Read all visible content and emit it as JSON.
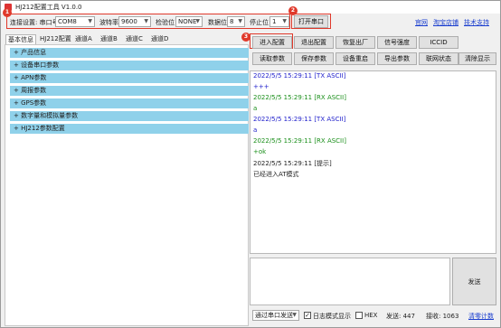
{
  "window": {
    "title": "HJ212配置工具 V1.0.0"
  },
  "toolbar": {
    "conn_label": "连接设置: 串口号",
    "port_value": "COM8",
    "baud_label": "波特率",
    "baud_value": "9600",
    "parity_label": "检验位",
    "parity_value": "NONE",
    "databits_label": "数据位",
    "databits_value": "8",
    "stopbits_label": "停止位",
    "stopbits_value": "1",
    "open_port_label": "打开串口",
    "links": [
      "官网",
      "淘宝店铺",
      "技术支持"
    ]
  },
  "annotations": {
    "badge1": "1",
    "badge2": "2",
    "badge3": "3"
  },
  "tabs": [
    "基本信息",
    "HJ212配置",
    "通道A",
    "通道B",
    "通道C",
    "通道D"
  ],
  "sections": [
    "+ 产品信息",
    "+ 设备串口参数",
    "+ APN参数",
    "+ 周报参数",
    "+ GPS参数",
    "+ 数字量和模拟量参数",
    "+ HJ212参数配置"
  ],
  "action_buttons": {
    "row1": [
      "进入配置",
      "退出配置",
      "恢复出厂",
      "信号强度",
      "ICCID"
    ],
    "row2": [
      "读取参数",
      "保存参数",
      "设备重启",
      "导出参数",
      "联网状态",
      "清除显示"
    ]
  },
  "log": [
    {
      "text": "2022/5/5 15:29:11 [TX ASCII]",
      "color": "blue"
    },
    {
      "text": "+++",
      "color": "blue"
    },
    {
      "text": "2022/5/5 15:29:11 [RX ASCII]",
      "color": "green"
    },
    {
      "text": "a",
      "color": "green"
    },
    {
      "text": "2022/5/5 15:29:11 [TX ASCII]",
      "color": "blue"
    },
    {
      "text": "a",
      "color": "blue"
    },
    {
      "text": "2022/5/5 15:29:11 [RX ASCII]",
      "color": "green"
    },
    {
      "text": "+ok",
      "color": "green"
    },
    {
      "text": "2022/5/5 15:29:11 [提示]",
      "color": "dark"
    },
    {
      "text": "已经进入AT模式",
      "color": "dark"
    }
  ],
  "send": {
    "button_label": "发送",
    "mode_value": "通过串口发送",
    "log_mode_label": "日志模式显示",
    "log_mode_checked": true,
    "hex_label": "HEX",
    "hex_checked": false,
    "sent_label": "发送: 447",
    "recv_label": "接收: 1063",
    "clear_count_label": "清零计数"
  },
  "colors": {
    "section_bg": "#8fd1ea",
    "annotation_red": "#e0392b",
    "tx_blue": "#2222cc",
    "rx_green": "#1a8f1a",
    "link_blue": "#1a3ecf"
  }
}
